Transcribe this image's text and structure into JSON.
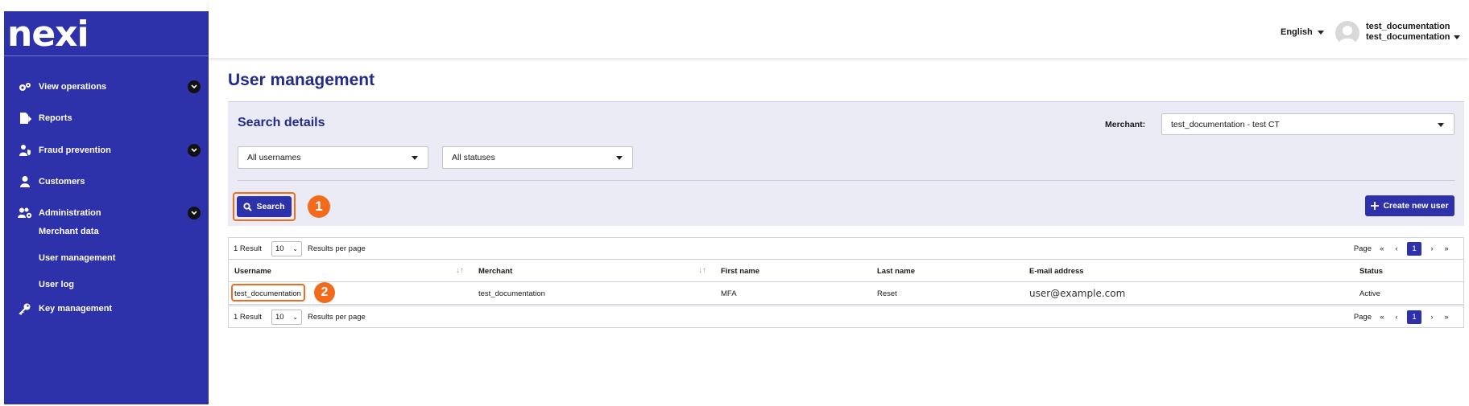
{
  "app": {
    "logo": "nexi"
  },
  "sidebar": {
    "items": [
      {
        "label": "View operations",
        "icon": "gears-icon",
        "expandable": true
      },
      {
        "label": "Reports",
        "icon": "report-export-icon",
        "expandable": false
      },
      {
        "label": "Fraud prevention",
        "icon": "user-shield-icon",
        "expandable": true
      },
      {
        "label": "Customers",
        "icon": "user-icon",
        "expandable": false
      },
      {
        "label": "Administration",
        "icon": "users-cog-icon",
        "expandable": true
      },
      {
        "label": "Key management",
        "icon": "key-icon",
        "expandable": false
      }
    ],
    "subitems": [
      "Merchant data",
      "User management",
      "User log"
    ]
  },
  "topbar": {
    "language": "English",
    "user_line1": "test_documentation",
    "user_line2": "test_documentation"
  },
  "page": {
    "title": "User management"
  },
  "search": {
    "title": "Search details",
    "merchant_label": "Merchant:",
    "merchant_value": "test_documentation - test CT",
    "usernames_value": "All usernames",
    "statuses_value": "All statuses",
    "search_button": "Search",
    "create_button": "Create new user",
    "step1": "1"
  },
  "results": {
    "count_label": "1 Result",
    "per_page_value": "10",
    "per_page_label": "Results per page",
    "page_label": "Page",
    "first": "«",
    "prev": "‹",
    "current_page": "1",
    "next": "›",
    "last": "»"
  },
  "table": {
    "headers": [
      "Username",
      "Merchant",
      "First name",
      "Last name",
      "E-mail address",
      "Status"
    ],
    "rows": [
      [
        "test_documentation",
        "test_documentation",
        "MFA",
        "Reset",
        "user@example.com",
        "Active"
      ]
    ],
    "step2": "2"
  },
  "colors": {
    "brand": "#2d32aa",
    "accent": "#f26b1d",
    "title": "#232a8a"
  }
}
